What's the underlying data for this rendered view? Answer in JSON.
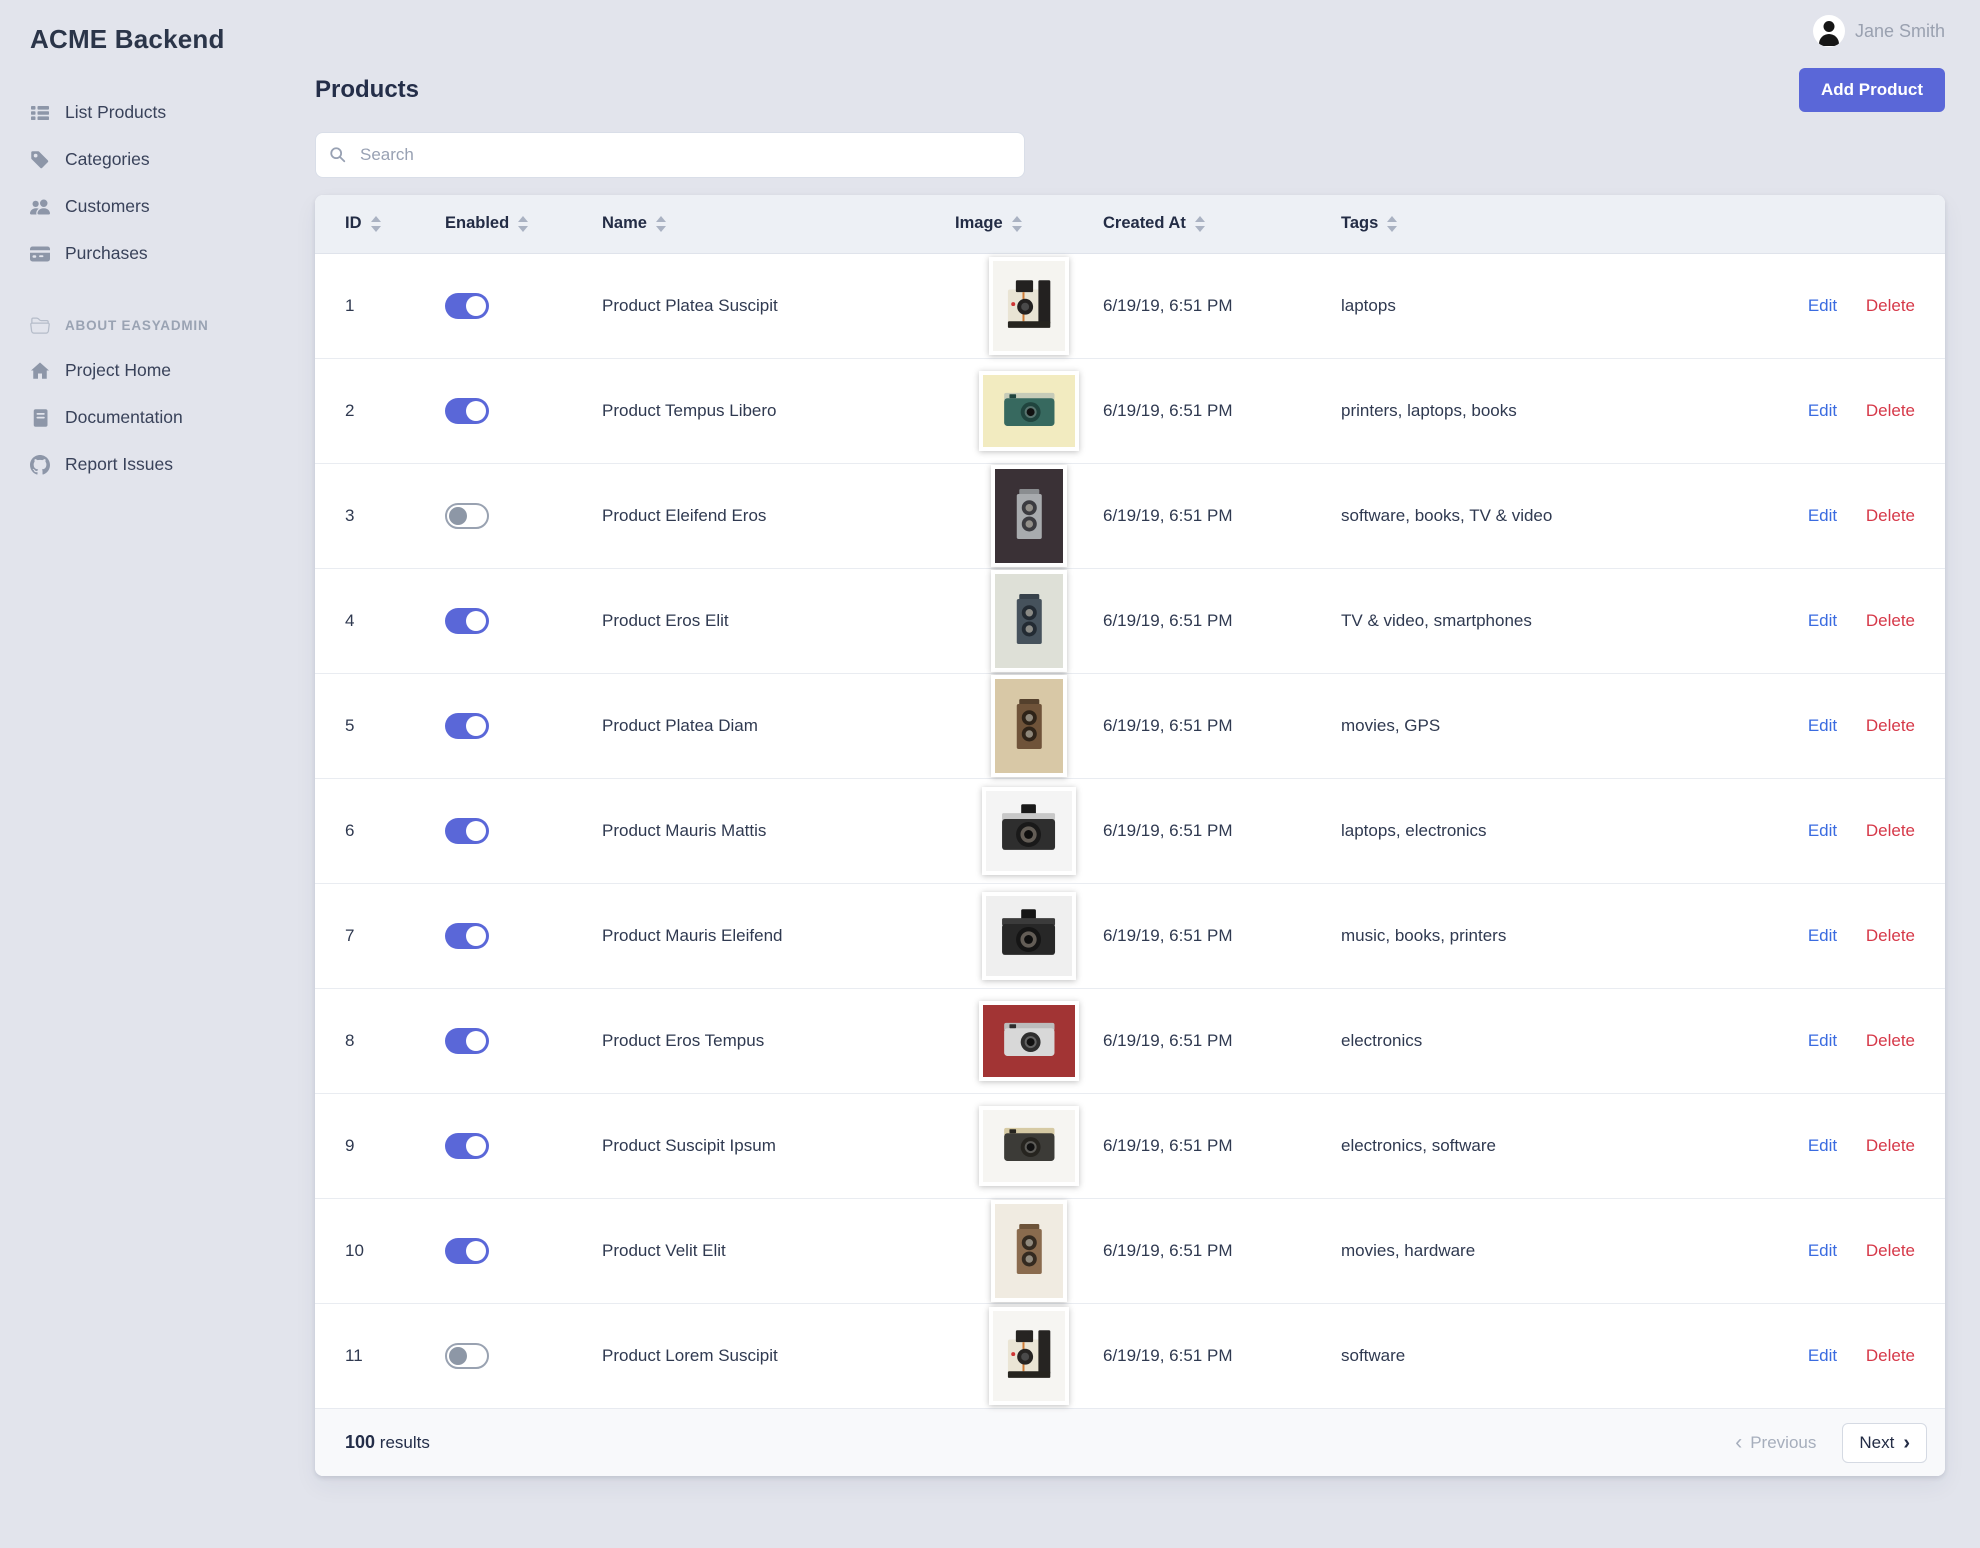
{
  "app": {
    "title": "ACME Backend",
    "user_name": "Jane Smith"
  },
  "sidebar": {
    "items": [
      {
        "label": "List Products",
        "icon": "list-icon"
      },
      {
        "label": "Categories",
        "icon": "tag-icon"
      },
      {
        "label": "Customers",
        "icon": "users-icon"
      },
      {
        "label": "Purchases",
        "icon": "credit-card-icon"
      }
    ],
    "section_label": "ABOUT EASYADMIN",
    "section_icon": "folder-open-icon",
    "section_items": [
      {
        "label": "Project Home",
        "icon": "home-icon"
      },
      {
        "label": "Documentation",
        "icon": "book-icon"
      },
      {
        "label": "Report Issues",
        "icon": "github-icon"
      }
    ]
  },
  "page": {
    "title": "Products"
  },
  "toolbar": {
    "add_button": "Add Product",
    "search_placeholder": "Search"
  },
  "table": {
    "columns": [
      "ID",
      "Enabled",
      "Name",
      "Image",
      "Created At",
      "Tags"
    ],
    "actions": {
      "edit": "Edit",
      "delete": "Delete"
    },
    "rows": [
      {
        "id": "1",
        "enabled": true,
        "name": "Product Platea Suscipit",
        "created_at": "6/19/19, 6:51 PM",
        "tags": "laptops",
        "image": {
          "variant": "polaroid",
          "bg": "#f5f4f0",
          "body": "#e9e4d4",
          "accent": "#232120",
          "accent2": "#3c3a36"
        }
      },
      {
        "id": "2",
        "enabled": true,
        "name": "Product Tempus Libero",
        "created_at": "6/19/19, 6:51 PM",
        "tags": "printers, laptops, books",
        "image": {
          "variant": "compact",
          "bg": "#f2ebc0",
          "body": "#37695f",
          "accent": "#20443e",
          "accent2": "#c6cbb8"
        }
      },
      {
        "id": "3",
        "enabled": false,
        "name": "Product Eleifend Eros",
        "created_at": "6/19/19, 6:51 PM",
        "tags": "software, books, TV & video",
        "image": {
          "variant": "tlr",
          "bg": "#3a3136",
          "body": "#a8abae",
          "accent": "#3b3b40",
          "accent2": "#8a8d90"
        }
      },
      {
        "id": "4",
        "enabled": true,
        "name": "Product Eros Elit",
        "created_at": "6/19/19, 6:51 PM",
        "tags": "TV & video, smartphones",
        "image": {
          "variant": "tlr",
          "bg": "#dee0d7",
          "body": "#46525c",
          "accent": "#232b33",
          "accent2": "#37424b"
        }
      },
      {
        "id": "5",
        "enabled": true,
        "name": "Product Platea Diam",
        "created_at": "6/19/19, 6:51 PM",
        "tags": "movies, GPS",
        "image": {
          "variant": "tlr",
          "bg": "#d8c8a6",
          "body": "#6f5339",
          "accent": "#2e2318",
          "accent2": "#54402c"
        }
      },
      {
        "id": "6",
        "enabled": true,
        "name": "Product Mauris Mattis",
        "created_at": "6/19/19, 6:51 PM",
        "tags": "laptops, electronics",
        "image": {
          "variant": "slr",
          "bg": "#f4f4f4",
          "body": "#2e2e2e",
          "accent": "#191919",
          "accent2": "#c8c8c8"
        }
      },
      {
        "id": "7",
        "enabled": true,
        "name": "Product Mauris Eleifend",
        "created_at": "6/19/19, 6:51 PM",
        "tags": "music, books, printers",
        "image": {
          "variant": "slr",
          "bg": "#efefef",
          "body": "#272727",
          "accent": "#151515",
          "accent2": "#3b3b3b"
        }
      },
      {
        "id": "8",
        "enabled": true,
        "name": "Product Eros Tempus",
        "created_at": "6/19/19, 6:51 PM",
        "tags": "electronics",
        "image": {
          "variant": "compact",
          "bg": "#a23434",
          "body": "#d8d8d8",
          "accent": "#2e2e2e",
          "accent2": "#bcbcbc"
        }
      },
      {
        "id": "9",
        "enabled": true,
        "name": "Product Suscipit Ipsum",
        "created_at": "6/19/19, 6:51 PM",
        "tags": "electronics, software",
        "image": {
          "variant": "compact",
          "bg": "#f6f5f2",
          "body": "#3c3b37",
          "accent": "#26241f",
          "accent2": "#d6caa4"
        }
      },
      {
        "id": "10",
        "enabled": true,
        "name": "Product Velit Elit",
        "created_at": "6/19/19, 6:51 PM",
        "tags": "movies, hardware",
        "image": {
          "variant": "tlr",
          "bg": "#f0ebe1",
          "body": "#8a6b4e",
          "accent": "#342a20",
          "accent2": "#6d5339"
        }
      },
      {
        "id": "11",
        "enabled": false,
        "name": "Product Lorem Suscipit",
        "created_at": "6/19/19, 6:51 PM",
        "tags": "software",
        "image": {
          "variant": "polaroid",
          "bg": "#f6f5f2",
          "body": "#eae5d5",
          "accent": "#262422",
          "accent2": "#3e3c38"
        }
      }
    ]
  },
  "footer": {
    "count": "100",
    "label": "results",
    "previous": "Previous",
    "next": "Next"
  },
  "colors": {
    "accent": "#5a67d8",
    "link": "#3a6be0",
    "danger": "#d63848",
    "page_bg": "#e2e4ec"
  }
}
